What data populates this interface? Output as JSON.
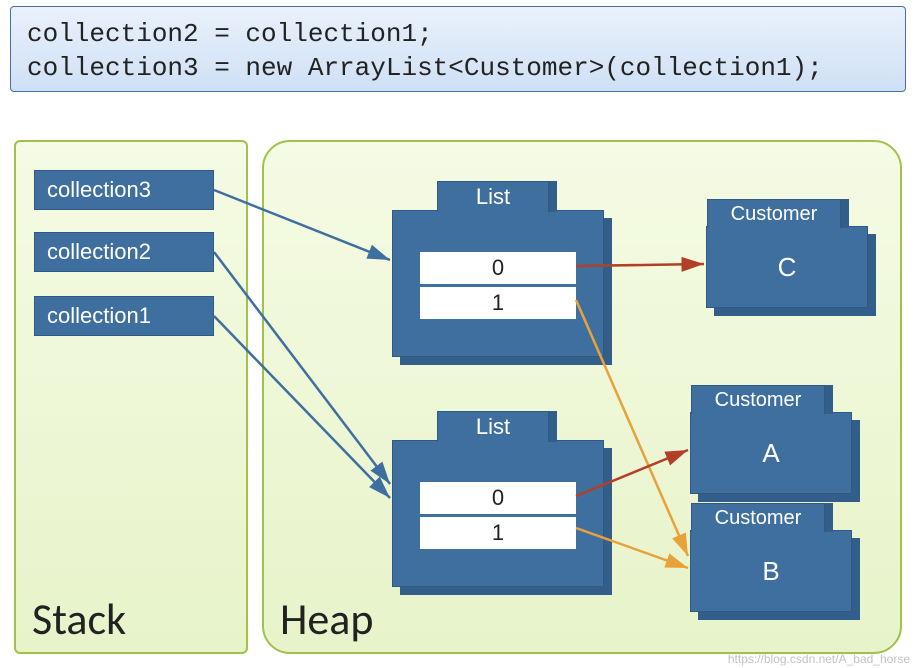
{
  "code_panel": {
    "line1": "collection2 = collection1;",
    "line2": "collection3 = new ArrayList<Customer>(collection1);"
  },
  "zones": {
    "stack_title": "Stack",
    "heap_title": "Heap"
  },
  "stack_vars": {
    "v3": "collection3",
    "v2": "collection2",
    "v1": "collection1"
  },
  "list_label": "List",
  "cell_index0": "0",
  "cell_index1": "1",
  "customer_label": "Customer",
  "customers": {
    "c": "C",
    "a": "A",
    "b": "B"
  },
  "semantics": {
    "description": "Diagram showing Java reference copy vs. shallow copy of a List<Customer>.",
    "stack_to_heap": [
      {
        "var": "collection3",
        "points_to": "List#1 (new ArrayList copy)"
      },
      {
        "var": "collection2",
        "points_to": "List#2 (same as collection1)"
      },
      {
        "var": "collection1",
        "points_to": "List#2"
      }
    ],
    "list1_elements": [
      {
        "index": 0,
        "points_to": "Customer C"
      },
      {
        "index": 1,
        "points_to": "Customer B"
      }
    ],
    "list2_elements": [
      {
        "index": 0,
        "points_to": "Customer A"
      },
      {
        "index": 1,
        "points_to": "Customer B"
      }
    ],
    "shared_customers": [
      "B"
    ]
  },
  "watermark": "https://blog.csdn.net/A_bad_horse"
}
